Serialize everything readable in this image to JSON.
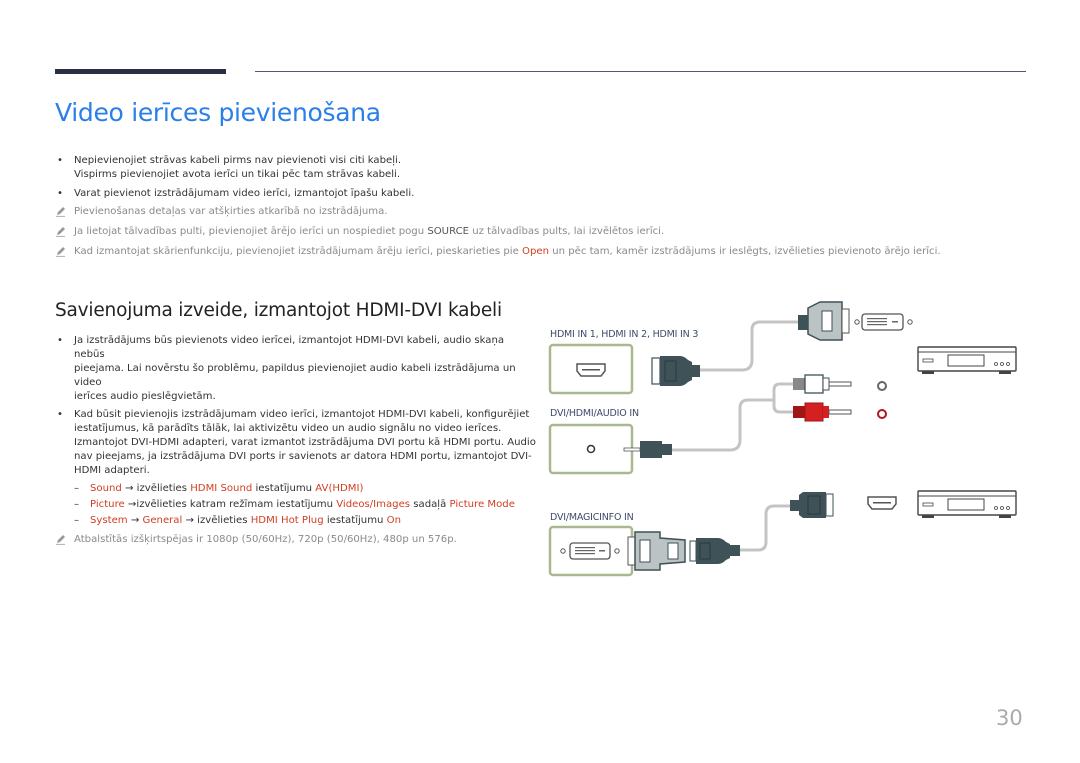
{
  "header": {
    "title": "Video ierīces pievienošana"
  },
  "intro": {
    "bullets": [
      {
        "lines": [
          "Nepievienojiet strāvas kabeli pirms nav pievienoti visi citi kabeļi.",
          "Vispirms pievienojiet avota ierīci un tikai pēc tam strāvas kabeli."
        ]
      },
      {
        "lines": [
          "Varat pievienot izstrādājumam video ierīci, izmantojot īpašu kabeli."
        ]
      }
    ],
    "notes": [
      {
        "text": "Pievienošanas detaļas var atšķirties atkarībā no izstrādājuma."
      },
      {
        "before": "Ja lietojat tālvadības pulti, pievienojiet ārējo ierīci un nospiediet pogu ",
        "bold": "SOURCE",
        "after": " uz tālvadības pults, lai izvēlētos ierīci."
      },
      {
        "before": "Kad izmantojat skārienfunkciju, pievienojiet izstrādājumam ārēju ierīci, pieskarieties pie ",
        "accent": "Open",
        "after": " un pēc tam, kamēr izstrādājums ir ieslēgts, izvēlieties pievienoto ārējo ierīci."
      }
    ]
  },
  "section": {
    "heading": "Savienojuma izveide, izmantojot HDMI-DVI kabeli",
    "bullets": [
      {
        "lines": [
          "Ja izstrādājums būs pievienots video ierīcei, izmantojot HDMI-DVI kabeli, audio skaņa nebūs",
          "pieejama. Lai novērstu šo problēmu, papildus pievienojiet audio kabeli izstrādājuma un video",
          "ierīces audio pieslēgvietām."
        ]
      },
      {
        "lines": [
          "Kad būsit pievienojis izstrādājumam video ierīci, izmantojot HDMI-DVI kabeli, konfigurējiet",
          "iestatījumus, kā parādīts tālāk, lai aktivizētu video un audio signālu no video ierīces.",
          "Izmantojot DVI-HDMI adapteri, varat izmantot izstrādājuma DVI portu kā HDMI portu. Audio",
          "nav pieejams, ja izstrādājuma DVI ports ir savienots ar datora HDMI portu, izmantojot DVI-",
          "HDMI adapteri."
        ]
      }
    ],
    "steps": [
      {
        "a1": "Sound",
        "t1": " → izvēlieties ",
        "a2": "HDMI Sound",
        "t2": " iestatījumu ",
        "a3": "AV(HDMI)",
        "t3": "",
        "a4": "",
        "t4": "",
        "a5": ""
      },
      {
        "a1": "Picture",
        "t1": " →izvēlieties katram režīmam iestatījumu ",
        "a2": "Videos/Images",
        "t2": " sadaļā ",
        "a3": "Picture Mode",
        "t3": "",
        "a4": "",
        "t4": "",
        "a5": ""
      },
      {
        "a1": "System",
        "t1": " → ",
        "a2": "General",
        "t2": " → izvēlieties ",
        "a3": "HDMI Hot Plug",
        "t3": " iestatījumu ",
        "a4": "On",
        "t4": "",
        "a5": ""
      }
    ],
    "note": "Atbalstītās izšķirtspējas ir 1080p (50/60Hz), 720p (50/60Hz), 480p un 576p."
  },
  "diagram": {
    "ports": [
      {
        "label": "HDMI IN 1, HDMI IN 2, HDMI IN 3"
      },
      {
        "label": "DVI/HDMI/AUDIO IN"
      },
      {
        "label": "DVI/MAGICINFO IN"
      }
    ],
    "colors": {
      "port_border": "#a9b88e",
      "plug": "#3e5257",
      "cable": "#bdbdbd",
      "audio_red": "#d42020",
      "title_blue": "#2a7fe8",
      "accent_red": "#d13e21"
    }
  },
  "footer": {
    "page_number": "30"
  }
}
